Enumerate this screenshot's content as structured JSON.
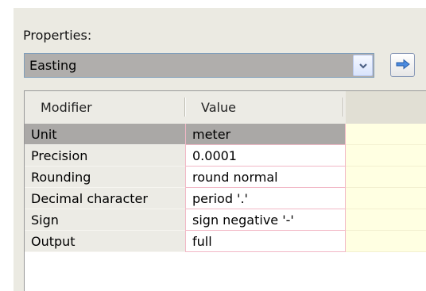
{
  "properties": {
    "label": "Properties:",
    "selected": "Easting"
  },
  "icons": {
    "dropdown": "chevron-down-icon",
    "go": "right-arrow-icon"
  },
  "grid": {
    "columns": [
      "Modifier",
      "Value"
    ],
    "rows": [
      {
        "modifier": "Unit",
        "value": "meter"
      },
      {
        "modifier": "Precision",
        "value": "0.0001"
      },
      {
        "modifier": "Rounding",
        "value": "round normal"
      },
      {
        "modifier": "Decimal character",
        "value": "period '.'"
      },
      {
        "modifier": "Sign",
        "value": "sign negative '-'"
      },
      {
        "modifier": "Output",
        "value": "full"
      }
    ],
    "selected_row": 0
  },
  "colors": {
    "selection": "#aaa8a6",
    "extra_column": "#ffffe2",
    "arrow": "#3a7bd5"
  }
}
